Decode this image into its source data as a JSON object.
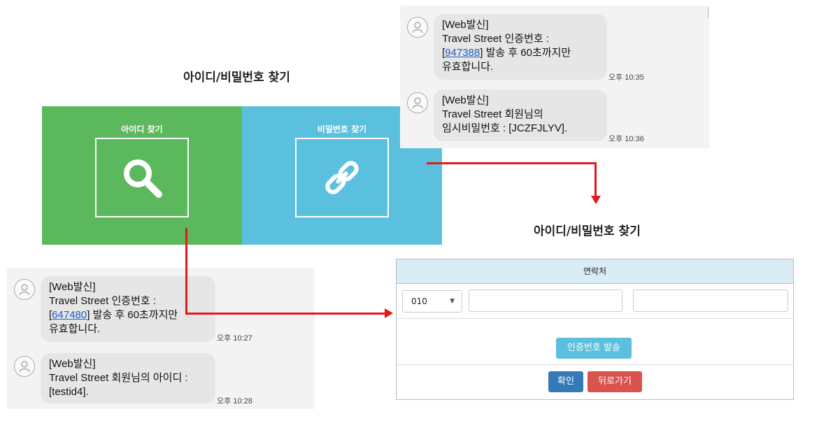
{
  "left_section": {
    "title": "아이디/비밀번호 찾기",
    "find_id": {
      "label": "아이디 찾기",
      "icon": "search-icon",
      "color": "#5cb85c"
    },
    "find_pw": {
      "label": "비밀번호 찾기",
      "icon": "link-icon",
      "color": "#5bc0de"
    }
  },
  "sms_top": {
    "msg1": {
      "line1": "[Web발신]",
      "line2": "Travel Street 인증번호 :",
      "code_prefix": "[",
      "code": "947388",
      "code_suffix": "] 발송 후 60초까지만",
      "line4": "유효합니다.",
      "time": "오후 10:35"
    },
    "msg2": {
      "line1": "[Web발신]",
      "line2": "Travel Street 회원님의",
      "line3": "임시비밀번호 : [JCZFJLYV].",
      "time": "오후 10:36"
    }
  },
  "sms_bottom": {
    "msg1": {
      "line1": "[Web발신]",
      "line2": "Travel Street 인증번호 :",
      "code_prefix": "[",
      "code": "647480",
      "code_suffix": "] 발송 후 60초까지만",
      "line4": "유효합니다.",
      "time": "오후 10:27"
    },
    "msg2": {
      "line1": "[Web발신]",
      "line2": "Travel Street 회원님의 아이디 :",
      "line3": "[testid4].",
      "time": "오후 10:28"
    }
  },
  "form": {
    "title": "아이디/비밀번호 찾기",
    "header": "연락처",
    "phone_prefix": "010",
    "phone_mid": "",
    "phone_last": "",
    "send_code_label": "인증번호 발송",
    "confirm_label": "확인",
    "back_label": "뒤로가기"
  },
  "colors": {
    "arrow": "#e41a1a",
    "info": "#5bc0de",
    "primary": "#337ab7",
    "danger": "#d9534f"
  }
}
